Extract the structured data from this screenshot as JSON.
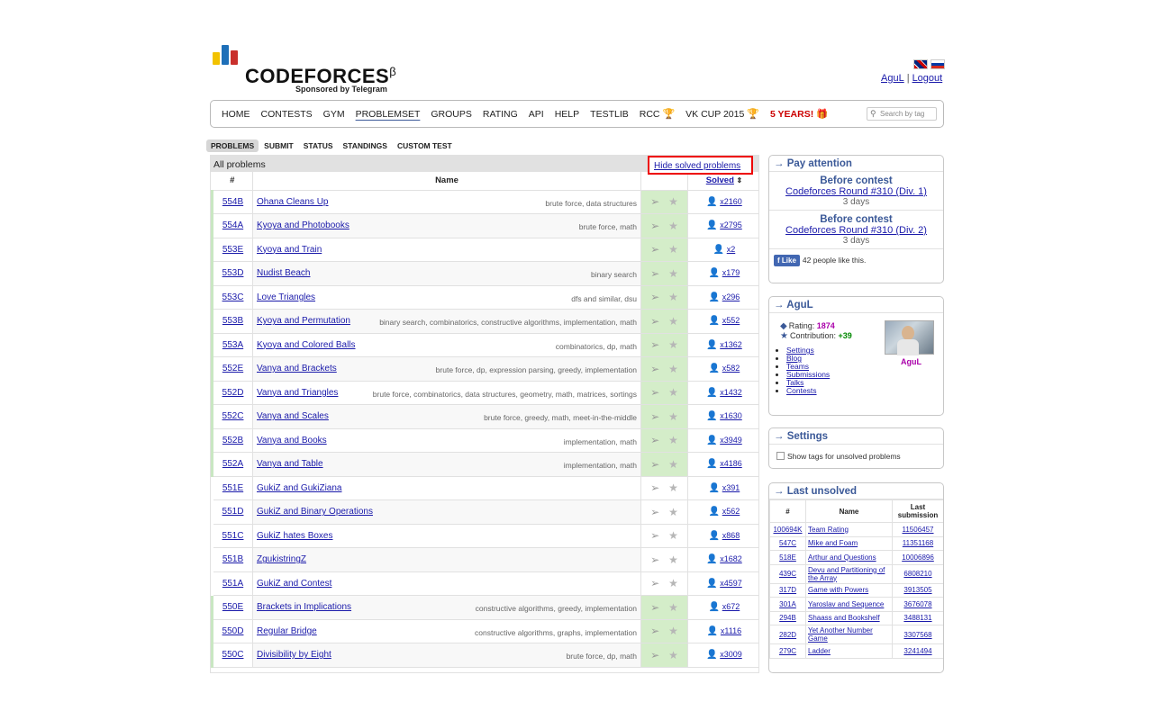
{
  "logo": {
    "wordmark": "CODEFORCES",
    "beta": "β",
    "sponsor": "Sponsored by Telegram"
  },
  "user": {
    "handle": "AguL",
    "logout": "Logout"
  },
  "menu": {
    "items": [
      "Home",
      "Contests",
      "Gym",
      "Problemset",
      "Groups",
      "Rating",
      "API",
      "Help",
      "TESTLIB",
      "RCC",
      "VK Cup 2015",
      "5 years!"
    ],
    "active": "Problemset",
    "search_placeholder": "Search by tag"
  },
  "submenu": {
    "items": [
      "PROBLEMS",
      "SUBMIT",
      "STATUS",
      "STANDINGS",
      "CUSTOM TEST"
    ],
    "active": "PROBLEMS"
  },
  "problems": {
    "caption": "All problems",
    "hide_solved": "Hide solved problems",
    "headers": {
      "id": "#",
      "name": "Name",
      "solved": "Solved",
      "sort_icon": "sort-arrows-icon"
    },
    "rows": [
      {
        "id": "554B",
        "name": "Ohana Cleans Up",
        "tags": "brute force, data structures",
        "solved": "x2160",
        "accepted": true
      },
      {
        "id": "554A",
        "name": "Kyoya and Photobooks",
        "tags": "brute force, math",
        "solved": "x2795",
        "accepted": true
      },
      {
        "id": "553E",
        "name": "Kyoya and Train",
        "tags": "",
        "solved": "x2",
        "accepted": true
      },
      {
        "id": "553D",
        "name": "Nudist Beach",
        "tags": "binary search",
        "solved": "x179",
        "accepted": true
      },
      {
        "id": "553C",
        "name": "Love Triangles",
        "tags": "dfs and similar, dsu",
        "solved": "x296",
        "accepted": true
      },
      {
        "id": "553B",
        "name": "Kyoya and Permutation",
        "tags": "binary search, combinatorics, constructive algorithms, implementation, math",
        "solved": "x552",
        "accepted": true
      },
      {
        "id": "553A",
        "name": "Kyoya and Colored Balls",
        "tags": "combinatorics, dp, math",
        "solved": "x1362",
        "accepted": true
      },
      {
        "id": "552E",
        "name": "Vanya and Brackets",
        "tags": "brute force, dp, expression parsing, greedy, implementation",
        "solved": "x582",
        "accepted": true
      },
      {
        "id": "552D",
        "name": "Vanya and Triangles",
        "tags": "brute force, combinatorics, data structures, geometry, math, matrices, sortings",
        "solved": "x1432",
        "accepted": true
      },
      {
        "id": "552C",
        "name": "Vanya and Scales",
        "tags": "brute force, greedy, math, meet-in-the-middle",
        "solved": "x1630",
        "accepted": true
      },
      {
        "id": "552B",
        "name": "Vanya and Books",
        "tags": "implementation, math",
        "solved": "x3949",
        "accepted": true
      },
      {
        "id": "552A",
        "name": "Vanya and Table",
        "tags": "implementation, math",
        "solved": "x4186",
        "accepted": true
      },
      {
        "id": "551E",
        "name": "GukiZ and GukiZiana",
        "tags": "",
        "solved": "x391",
        "accepted": false
      },
      {
        "id": "551D",
        "name": "GukiZ and Binary Operations",
        "tags": "",
        "solved": "x562",
        "accepted": false
      },
      {
        "id": "551C",
        "name": "GukiZ hates Boxes",
        "tags": "",
        "solved": "x868",
        "accepted": false
      },
      {
        "id": "551B",
        "name": "ZgukistringZ",
        "tags": "",
        "solved": "x1682",
        "accepted": false
      },
      {
        "id": "551A",
        "name": "GukiZ and Contest",
        "tags": "",
        "solved": "x4597",
        "accepted": false
      },
      {
        "id": "550E",
        "name": "Brackets in Implications",
        "tags": "constructive algorithms, greedy, implementation",
        "solved": "x672",
        "accepted": true
      },
      {
        "id": "550D",
        "name": "Regular Bridge",
        "tags": "constructive algorithms, graphs, implementation",
        "solved": "x1116",
        "accepted": true
      },
      {
        "id": "550C",
        "name": "Divisibility by Eight",
        "tags": "brute force, dp, math",
        "solved": "x3009",
        "accepted": true
      }
    ],
    "icons": {
      "submit": "paper-plane-icon",
      "favourite": "star-icon",
      "solved_user": "user-icon"
    }
  },
  "sidebar": {
    "pay_attention": {
      "title": "→ Pay attention",
      "contests": [
        {
          "header": "Before contest",
          "name": "Codeforces Round #310 (Div. 1)",
          "days": "3 days"
        },
        {
          "header": "Before contest",
          "name": "Codeforces Round #310 (Div. 2)",
          "days": "3 days"
        }
      ],
      "like_label": "Like",
      "like_text": "42 people like this."
    },
    "profile": {
      "title": "→ AguL",
      "rating_label": "Rating:",
      "rating": "1874",
      "contribution_label": "Contribution:",
      "contribution": "+39",
      "links": [
        "Settings",
        "Blog",
        "Teams",
        "Submissions",
        "Talks",
        "Contests"
      ],
      "username": "AguL"
    },
    "settings": {
      "title": "→ Settings",
      "option": "Show tags for unsolved problems"
    },
    "last_unsolved": {
      "title": "→ Last unsolved",
      "headers": {
        "id": "#",
        "name": "Name",
        "submission": "Last submission"
      },
      "rows": [
        {
          "id": "100694K",
          "name": "Team Rating",
          "submission": "11506457"
        },
        {
          "id": "547C",
          "name": "Mike and Foam",
          "submission": "11351168"
        },
        {
          "id": "518E",
          "name": "Arthur and Questions",
          "submission": "10006896"
        },
        {
          "id": "439C",
          "name": "Devu and Partitioning of the Array",
          "submission": "6808210"
        },
        {
          "id": "317D",
          "name": "Game with Powers",
          "submission": "3913505"
        },
        {
          "id": "301A",
          "name": "Yaroslav and Sequence",
          "submission": "3676078"
        },
        {
          "id": "294B",
          "name": "Shaass and Bookshelf",
          "submission": "3488131"
        },
        {
          "id": "282D",
          "name": "Yet Another Number Game",
          "submission": "3307568"
        },
        {
          "id": "279C",
          "name": "Ladder",
          "submission": "3241494"
        }
      ]
    }
  },
  "colors": {
    "accent": "#3b5998",
    "accepted_bg": "#d4edc9",
    "highlight": "#ee0000",
    "link": "#1a1aaa"
  }
}
